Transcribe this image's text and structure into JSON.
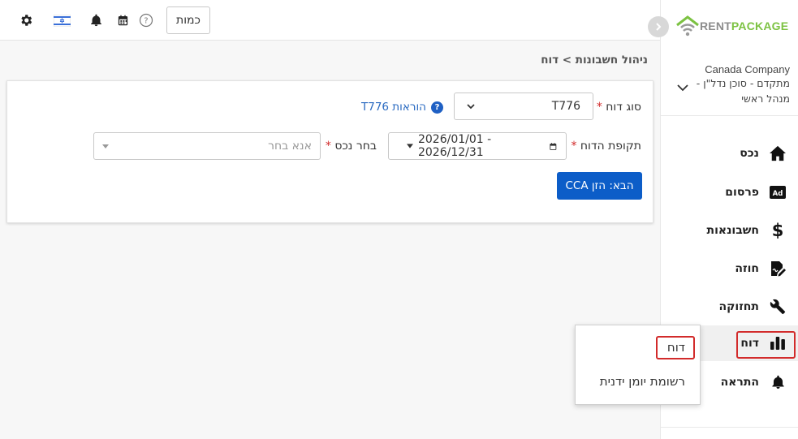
{
  "topbar": {
    "quantity_button": "כמות",
    "icons": [
      "gear-icon",
      "israel-flag-icon",
      "bell-icon",
      "calendar-icon",
      "help-icon"
    ]
  },
  "sidebar": {
    "logo": {
      "rent": "RENT",
      "package": "PACKAGE"
    },
    "company_name": "Canada Company",
    "company_role_line1": "מתקדם - סוכן נדל\"ן -",
    "company_role_line2": "מנהל ראשי",
    "items": [
      {
        "label": "נכס",
        "icon": "home-icon"
      },
      {
        "label": "פרסום",
        "icon": "ad-icon"
      },
      {
        "label": "חשבונאות",
        "icon": "dollar-icon"
      },
      {
        "label": "חוזה",
        "icon": "contract-icon"
      },
      {
        "label": "תחזוקה",
        "icon": "wrench-icon"
      },
      {
        "label": "דוח",
        "icon": "chart-icon",
        "active": true
      },
      {
        "label": "התראה",
        "icon": "bell-icon"
      }
    ]
  },
  "breadcrumb": "ניהול חשבונות > דוח",
  "form": {
    "report_type_label": "סוג דוח",
    "report_type_value": "T776",
    "help_link": "הוראות T776",
    "period_label": "תקופת הדוח",
    "period_value": "2026/01/01 - 2026/12/31",
    "property_label": "בחר נכס",
    "property_placeholder": "אנא בחר",
    "next_button": "הבא: הזן CCA"
  },
  "popup": {
    "items": [
      "דוח",
      "רשומת יומן ידנית"
    ]
  },
  "colors": {
    "accent": "#0c5dc8",
    "highlight": "#d22b2b",
    "logo_green": "#7cc242"
  }
}
